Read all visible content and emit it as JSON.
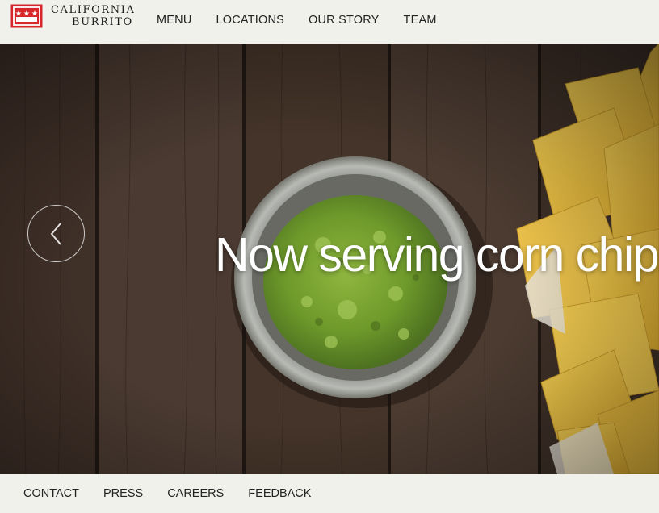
{
  "brand": {
    "name_line1": "CALIFORNIA",
    "name_line2": "BURRITO",
    "flag_colors": {
      "red": "#d7262a",
      "white": "#ffffff"
    }
  },
  "nav": {
    "items": [
      {
        "label": "MENU"
      },
      {
        "label": "LOCATIONS"
      },
      {
        "label": "OUR STORY"
      },
      {
        "label": "TEAM"
      }
    ]
  },
  "hero": {
    "headline": "Now serving corn chips",
    "prev_icon": "chevron-left-icon"
  },
  "footer": {
    "items": [
      {
        "label": "CONTACT"
      },
      {
        "label": "PRESS"
      },
      {
        "label": "CAREERS"
      },
      {
        "label": "FEEDBACK"
      }
    ]
  },
  "colors": {
    "bar_background": "#f1f1ec",
    "text": "#222222"
  }
}
